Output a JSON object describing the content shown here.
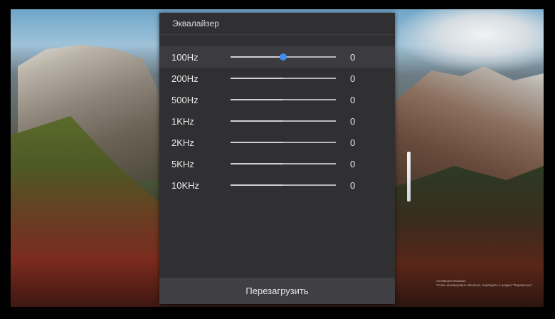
{
  "equalizer": {
    "title": "Эквалайзер",
    "bands": [
      {
        "label": "100Hz",
        "value": "0",
        "level": 0.5,
        "active": true
      },
      {
        "label": "200Hz",
        "value": "0",
        "level": 0.5,
        "active": false
      },
      {
        "label": "500Hz",
        "value": "0",
        "level": 0.5,
        "active": false
      },
      {
        "label": "1KHz",
        "value": "0",
        "level": 0.5,
        "active": false
      },
      {
        "label": "2KHz",
        "value": "0",
        "level": 0.5,
        "active": false
      },
      {
        "label": "5KHz",
        "value": "0",
        "level": 0.5,
        "active": false
      },
      {
        "label": "10KHz",
        "value": "0",
        "level": 0.5,
        "active": false
      }
    ],
    "reset_label": "Перезагрузить"
  },
  "wallpaper": {
    "activation_line1": "Активация Windows",
    "activation_line2": "Чтобы активировать Windows, перейдите в раздел \"Параметры\"."
  },
  "colors": {
    "accent": "#3d8ef0",
    "panel_bg": "#303033"
  }
}
